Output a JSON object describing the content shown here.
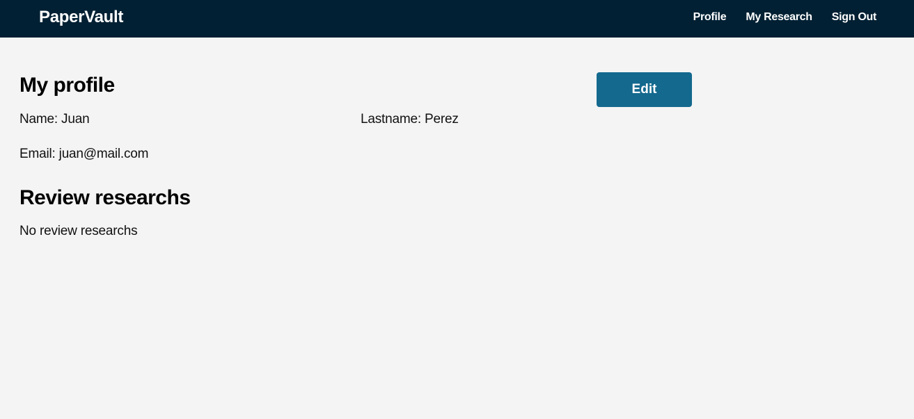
{
  "app": {
    "brand": "PaperVault"
  },
  "nav": {
    "items": [
      {
        "label": "Profile"
      },
      {
        "label": "My Research"
      },
      {
        "label": "Sign Out"
      }
    ]
  },
  "profile": {
    "title": "My profile",
    "edit_label": "Edit",
    "name_text": "Name: Juan",
    "lastname_text": "Lastname: Perez",
    "email_text": "Email: juan@mail.com"
  },
  "reviews": {
    "title": "Review researchs",
    "empty_text": "No review researchs"
  },
  "colors": {
    "navbar_bg": "#012033",
    "accent": "#13698e",
    "page_bg": "#f4f4f4"
  }
}
